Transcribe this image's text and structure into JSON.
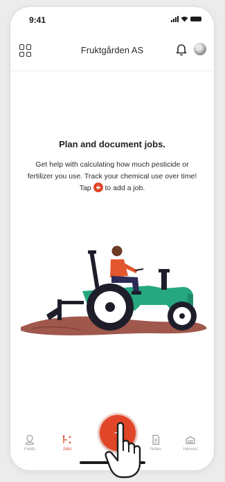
{
  "status_bar": {
    "time": "9:41"
  },
  "header": {
    "title": "Fruktgården AS"
  },
  "empty_state": {
    "headline": "Plan and document jobs.",
    "body_before_icon": "Get help with calculating how much pesticide or fertilizer you use. Track your chemical use over time! Tap",
    "body_after_icon": "to add a job."
  },
  "bottom_nav": {
    "items": [
      {
        "label": "Fields",
        "icon": "map-pin-icon",
        "active": false
      },
      {
        "label": "Jobs",
        "icon": "jobs-icon",
        "active": true
      },
      {
        "label": "Notes",
        "icon": "document-icon",
        "active": false
      },
      {
        "label": "Harvest",
        "icon": "harvest-icon",
        "active": false
      }
    ]
  },
  "fab": {
    "label": "+"
  },
  "colors": {
    "accent": "#e14628",
    "tractor_body": "#25a77f",
    "soil": "#a0584d",
    "shirt": "#e2572e"
  }
}
